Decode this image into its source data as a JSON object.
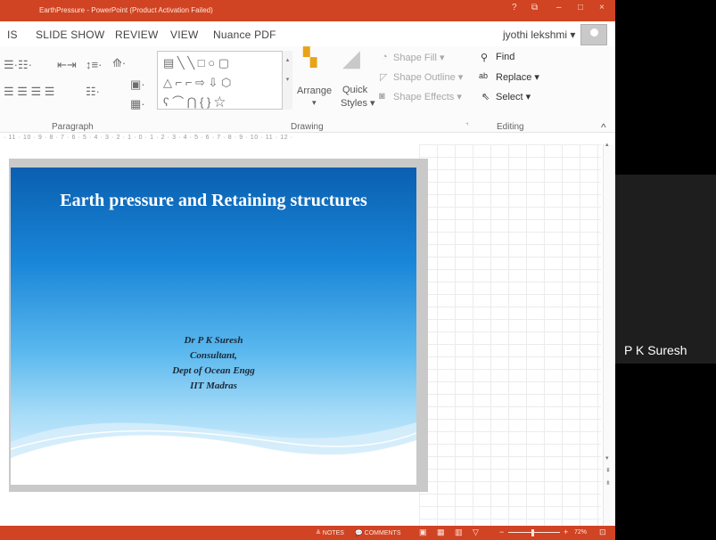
{
  "window": {
    "title": "EarthPressure - PowerPoint (Product Activation Failed)",
    "controls": [
      "?",
      "⧉",
      "–",
      "□",
      "×"
    ]
  },
  "menu": {
    "tabs": [
      "IS",
      "SLIDE SHOW",
      "REVIEW",
      "VIEW",
      "Nuance PDF"
    ],
    "user": "jyothi lekshmi ▾"
  },
  "ribbon": {
    "groups": {
      "paragraph": "Paragraph",
      "drawing": "Drawing",
      "editing": "Editing"
    },
    "arrange": "Arrange",
    "quick_styles": [
      "Quick",
      "Styles ▾"
    ],
    "shape_fill": "Shape Fill ▾",
    "shape_outline": "Shape Outline ▾",
    "shape_effects": "Shape Effects ▾",
    "find": "Find",
    "replace": "Replace ▾",
    "select": "Select ▾",
    "collapse": "^"
  },
  "ruler": "· 11 · 10 · 9 · 8 · 7 · 6 · 5 · 4 · 3 · 2 · 1 · 0 · 1 · 2 · 3 · 4 · 5 · 6 · 7 · 8 · 9 · 10 · 11 · 12 ·",
  "slide": {
    "title": "Earth pressure and Retaining structures",
    "author_lines": [
      "Dr P K Suresh",
      "Consultant,",
      "Dept of Ocean Engg",
      "IIT Madras"
    ]
  },
  "statusbar": {
    "notes": "≜ NOTES",
    "comments": "💬 COMMENTS",
    "zoom": "72%"
  },
  "participant": {
    "name": "P K Suresh"
  }
}
